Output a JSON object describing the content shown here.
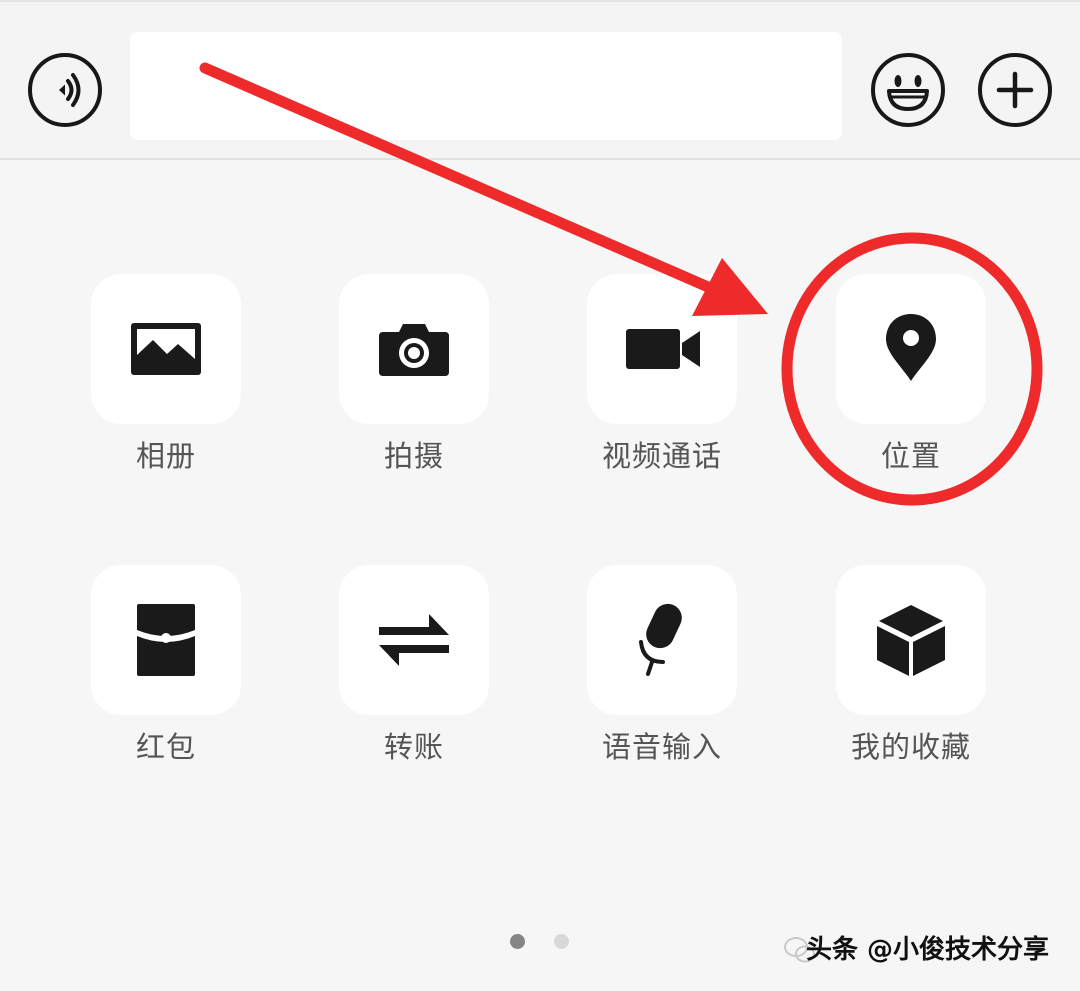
{
  "input_bar": {
    "voice_icon": "voice-wave-icon",
    "message_value": "",
    "emoji_icon": "smiley-face-icon",
    "more_icon": "plus-circle-icon"
  },
  "panel": {
    "items": [
      {
        "label": "相册",
        "icon": "photo-album-icon"
      },
      {
        "label": "拍摄",
        "icon": "camera-icon"
      },
      {
        "label": "视频通话",
        "icon": "video-call-icon"
      },
      {
        "label": "位置",
        "icon": "location-pin-icon"
      },
      {
        "label": "红包",
        "icon": "red-packet-icon"
      },
      {
        "label": "转账",
        "icon": "transfer-arrows-icon"
      },
      {
        "label": "语音输入",
        "icon": "microphone-icon"
      },
      {
        "label": "我的收藏",
        "icon": "favorites-cube-icon"
      }
    ],
    "page_indicator": {
      "current": 1,
      "total": 2
    }
  },
  "annotation": {
    "color": "#ee2a2a",
    "highlighted_item": "位置"
  },
  "watermark": {
    "text": "头条 @小俊技术分享"
  },
  "colors": {
    "background": "#f6f6f6",
    "tile": "#ffffff",
    "icon": "#1a1a1a",
    "label": "#555555"
  }
}
